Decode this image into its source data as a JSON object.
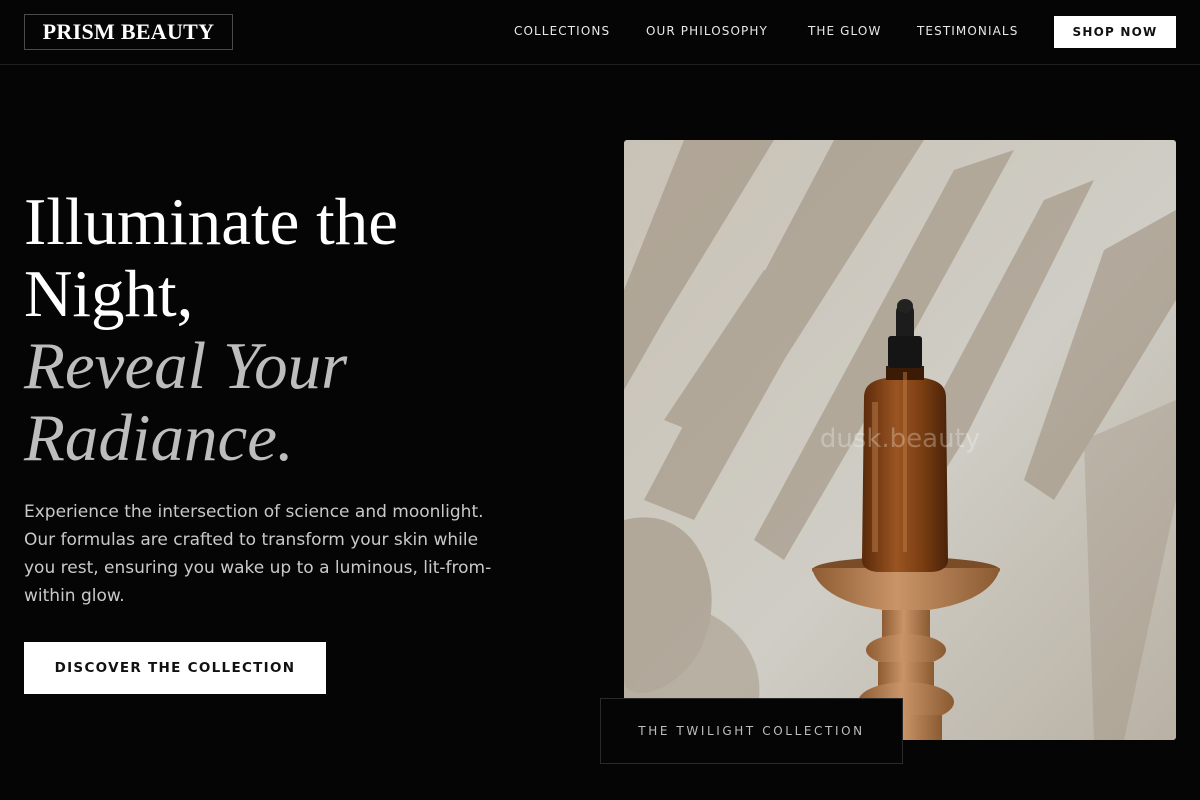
{
  "header": {
    "logo": "PRISM BEAUTY",
    "nav": [
      {
        "label": "COLLECTIONS"
      },
      {
        "label": "OUR PHILOSOPHY"
      },
      {
        "label": "THE GLOW"
      },
      {
        "label": "TESTIMONIALS"
      }
    ],
    "shop_label": "SHOP NOW"
  },
  "hero": {
    "headline_line1": "Illuminate the",
    "headline_line2": "Night,",
    "headline_line3": "Reveal Your",
    "headline_line4": "Radiance.",
    "body": "Experience the intersection of science and moonlight. Our formulas are crafted to transform your skin while you rest, ensuring you wake up to a luminous, lit-from-within glow.",
    "cta_label": "DISCOVER THE COLLECTION"
  },
  "feature": {
    "image_watermark": "dusk.beauty",
    "caption": "THE TWILIGHT COLLECTION"
  },
  "colors": {
    "background": "#050505",
    "text": "#ffffff",
    "muted_text": "#bdbdbd",
    "button_bg": "#ffffff",
    "button_text": "#111111",
    "bottle_amber": "#7a3e12"
  }
}
